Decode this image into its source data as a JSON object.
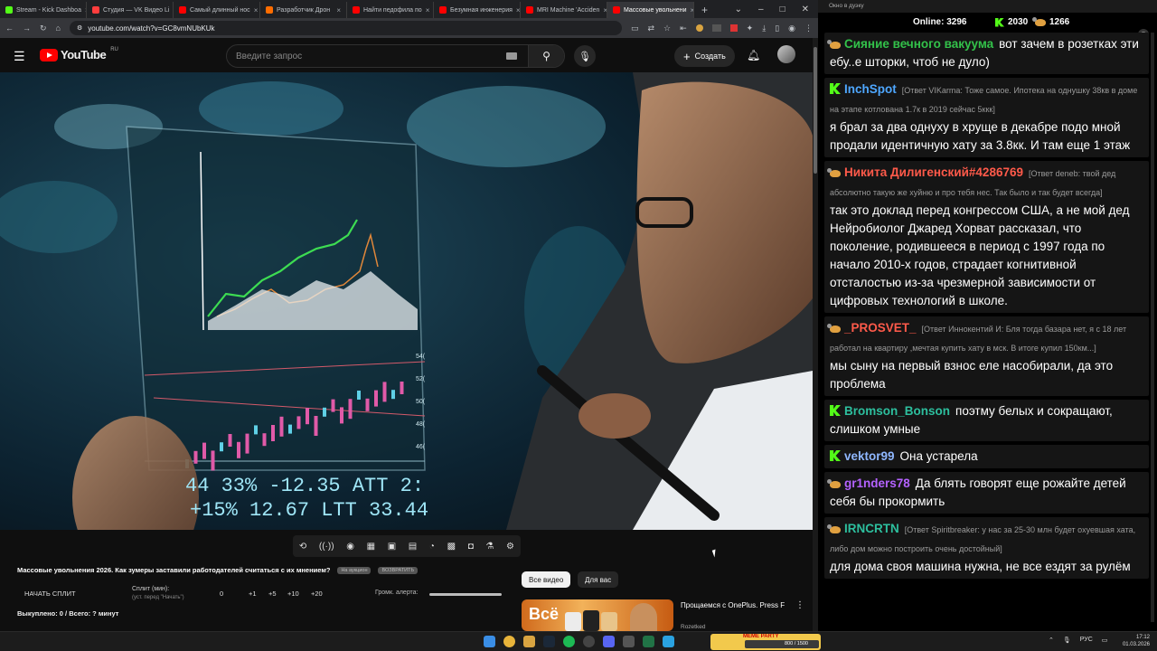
{
  "browser": {
    "tabs": [
      {
        "label": "Stream - Kick Dashboa",
        "color": "#53fc18"
      },
      {
        "label": "Студия — VK Видео Li",
        "color": "#ff3d3d"
      },
      {
        "label": "Самый длинный нос",
        "color": "#ff0000"
      },
      {
        "label": "Разработчик Дрон",
        "color": "#ff6d00"
      },
      {
        "label": "Найти педофила по ",
        "color": "#ff0000"
      },
      {
        "label": "Безумная инженерия",
        "color": "#ff0000"
      },
      {
        "label": "MRI Machine 'Acciden",
        "color": "#ff0000"
      },
      {
        "label": "Массовые увольнени",
        "color": "#ff0000",
        "active": true
      }
    ],
    "new_tab": "+",
    "url": "youtube.com/watch?v=GC8vmNUbKUk"
  },
  "youtube": {
    "logo": "YouTube",
    "region": "RU",
    "search_placeholder": "Введите запрос",
    "create_label": "Создать"
  },
  "video": {
    "title": "Массовые увольнения 2026. Как зумеры заставили работодателей считаться с их мнением?",
    "tag1": "На аукцион",
    "tag2": "ВОЗВРАТИТЬ",
    "overlay_row1": "44 33% -12.35 ATT 2:",
    "overlay_row2": "+15% 12.67 LTT 33.44",
    "axis_ticks": [
      "54(",
      "52(",
      "50(",
      "48(",
      "46("
    ]
  },
  "split": {
    "start_label": "НАЧАТЬ СПЛИТ",
    "minutes_label": "Сплит (мин):",
    "minutes_sub": "(уст. перед \"Начать\")",
    "values": [
      "0",
      "+1",
      "+5",
      "+10",
      "+20"
    ],
    "volume_label": "Громк. алерта:",
    "bought": "Выкуплено: 0 / Всего: ? минут"
  },
  "chips": {
    "all": "Все видео",
    "for_you": "Для вас"
  },
  "recommendation": {
    "thumb_text": "Всё",
    "title": "Прощаемся с OnePlus. Press F",
    "channel": "Rozetked",
    "menu": "⋮"
  },
  "chat": {
    "window_title": "Окно в дуэку",
    "online_label": "Online:",
    "online_count": "3296",
    "kick_count": "2030",
    "twitch_count": "1266",
    "messages": [
      {
        "platform": "duck",
        "nick": "Сияние вечного вакуума",
        "color": "#33c24a",
        "reply": "",
        "text": "вот зачем в розетках эти ебу..е шторки, чтоб не дуло)"
      },
      {
        "platform": "kick",
        "nick": "InchSpot",
        "color": "#4ea7ff",
        "reply": "[Ответ VIKarma: Тоже самое. Ипотека на однушку 38кв в доме на этапе котлована 1.7к в 2019 сейчас 5ккк]",
        "text": "я брал за два однуху в хруще в декабре подо мной продали идентичную хату за 3.8кк. И там еще 1 этаж"
      },
      {
        "platform": "duck",
        "nick": "Никита Дилигенский#4286769",
        "color": "#ff5a4a",
        "reply": "[Ответ deneb: твой дед абсолютно такую же хуйню и про тебя нес. Так было и так будет всегда]",
        "text": "так это доклад перед конгрессом США, а не мой дед Нейробиолог Джаред Хорват рассказал, что поколение, родившееся в период с 1997 года по начало 2010-х годов, страдает когнитивной отсталостью из-за чрезмерной зависимости от цифровых технологий в школе."
      },
      {
        "platform": "duck",
        "nick": "_PROSVET_",
        "color": "#ff5a4a",
        "reply": "[Ответ Иннокентий И: Бля тогда базара нет, я с 18 лет работал на квартиру ,мечтая купить хату в мск. В итоге купил 150км...]",
        "text": "мы сыну на первый взнос еле насобирали, да это проблема"
      },
      {
        "platform": "kick",
        "nick": "Bromson_Bonson",
        "color": "#2dbf9e",
        "reply": "",
        "text": "поэтму белых и сокращают, слишком умные"
      },
      {
        "platform": "kick",
        "nick": "vektor99",
        "color": "#8fb7ff",
        "reply": "",
        "text": "Она устарела"
      },
      {
        "platform": "duck",
        "nick": "gr1nders78",
        "color": "#b462ff",
        "reply": "",
        "text": "Да блять говорят еще рожайте детей себя бы прокормить"
      },
      {
        "platform": "duck",
        "nick": "IRNCRTN",
        "color": "#2dbf9e",
        "reply": "[Ответ Spiritbreaker: у нас за 25-30 млн будет охуевшая хата, либо дом можно построить очень достойный]",
        "text": "для дома своя машина нужна, не все ездят за рулём"
      }
    ]
  },
  "taskbar": {
    "meme_label": "MEME PARTY",
    "meme_progress": "800 / 1500",
    "lang": "РУС",
    "time": "17:12",
    "date": "01.03.2026"
  }
}
